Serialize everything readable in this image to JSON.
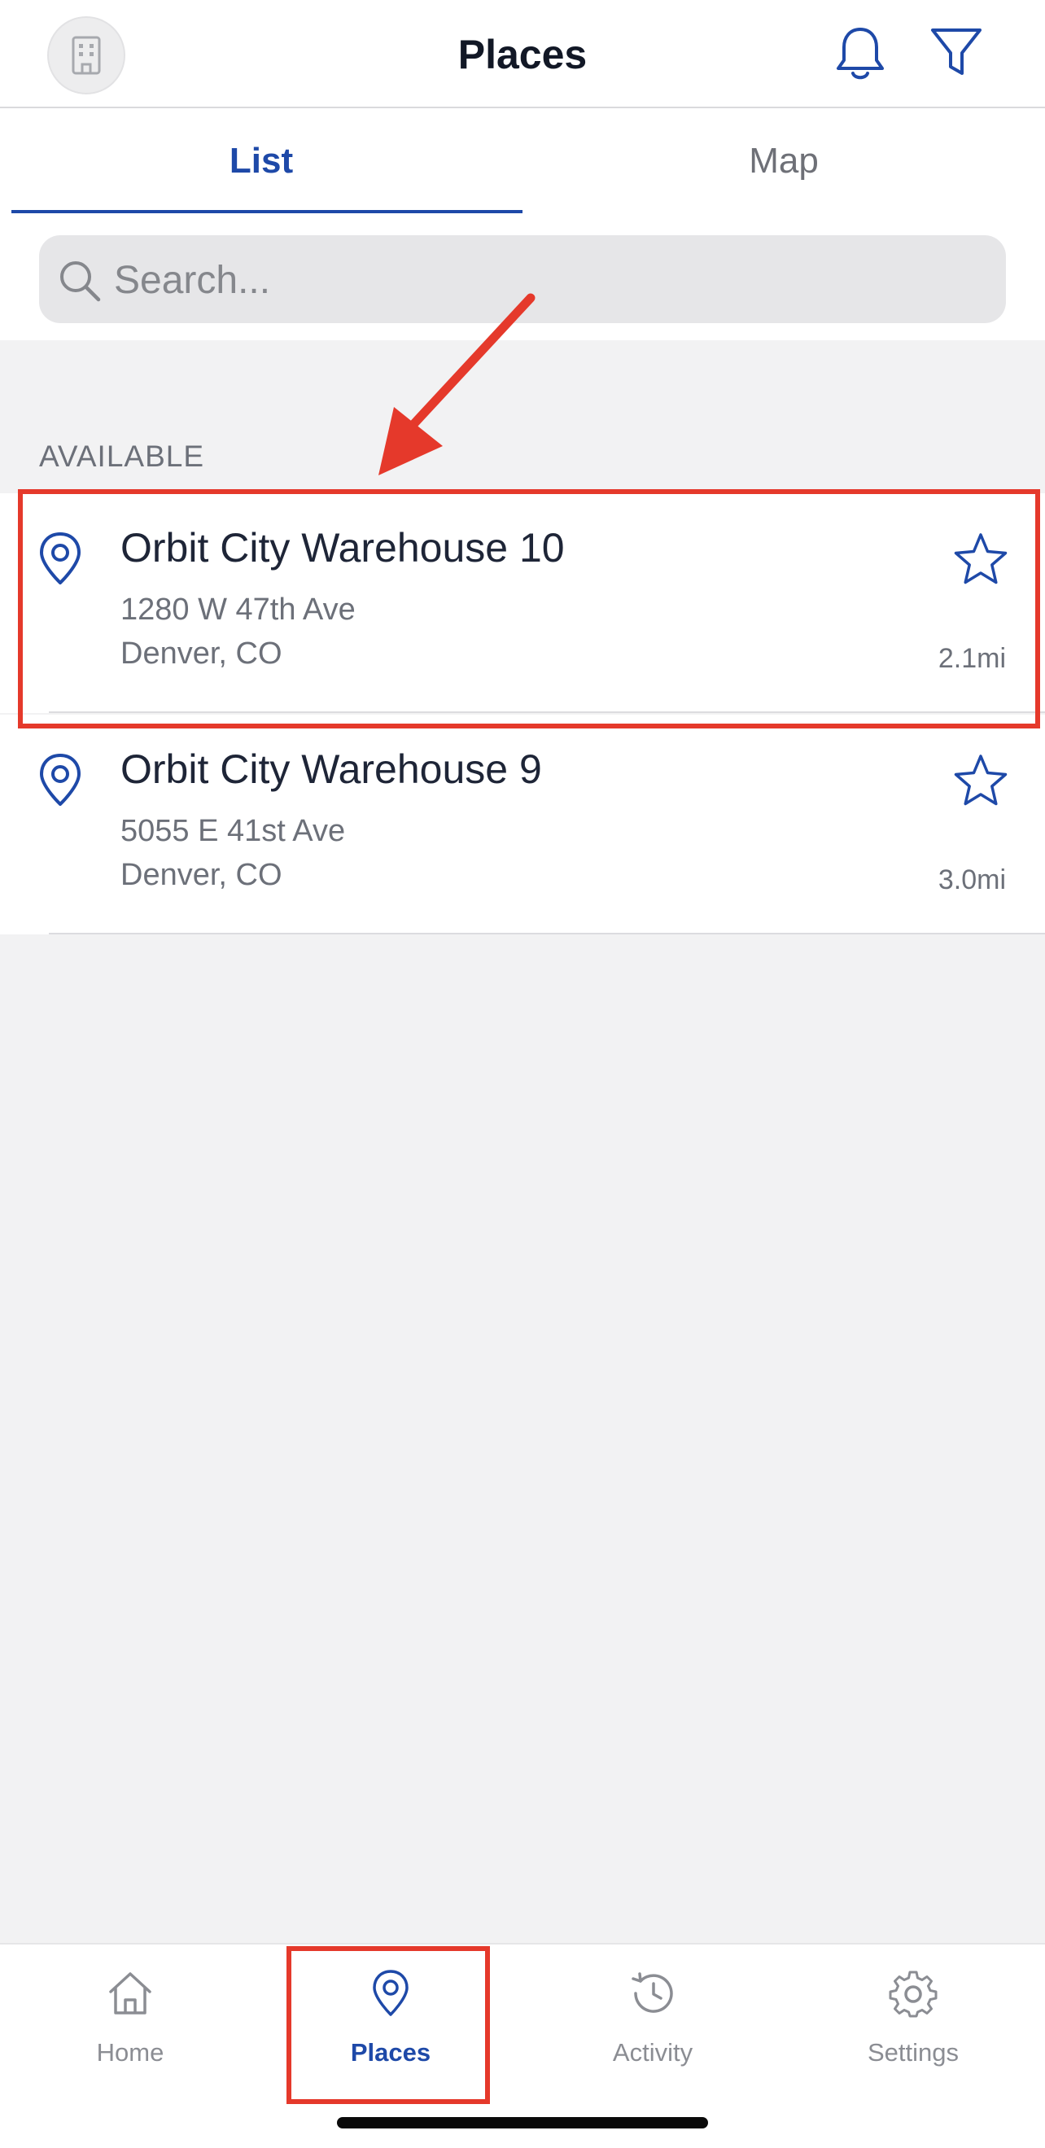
{
  "header": {
    "title": "Places"
  },
  "tabs": [
    {
      "label": "List",
      "active": true
    },
    {
      "label": "Map",
      "active": false
    }
  ],
  "search": {
    "placeholder": "Search...",
    "value": ""
  },
  "section": {
    "title": "AVAILABLE"
  },
  "places": [
    {
      "name": "Orbit City Warehouse 10",
      "address": "1280 W 47th Ave",
      "city": "Denver, CO",
      "distance": "2.1mi"
    },
    {
      "name": "Orbit City Warehouse 9",
      "address": "5055 E 41st Ave",
      "city": "Denver, CO",
      "distance": "3.0mi"
    }
  ],
  "nav": {
    "items": [
      {
        "label": "Home",
        "icon": "home-icon",
        "active": false
      },
      {
        "label": "Places",
        "icon": "map-pin-icon",
        "active": true
      },
      {
        "label": "Activity",
        "icon": "history-icon",
        "active": false
      },
      {
        "label": "Settings",
        "icon": "gear-icon",
        "active": false
      }
    ]
  },
  "colors": {
    "accent": "#1E49A8",
    "annotation": "#E5392B",
    "background": "#F2F2F3"
  }
}
